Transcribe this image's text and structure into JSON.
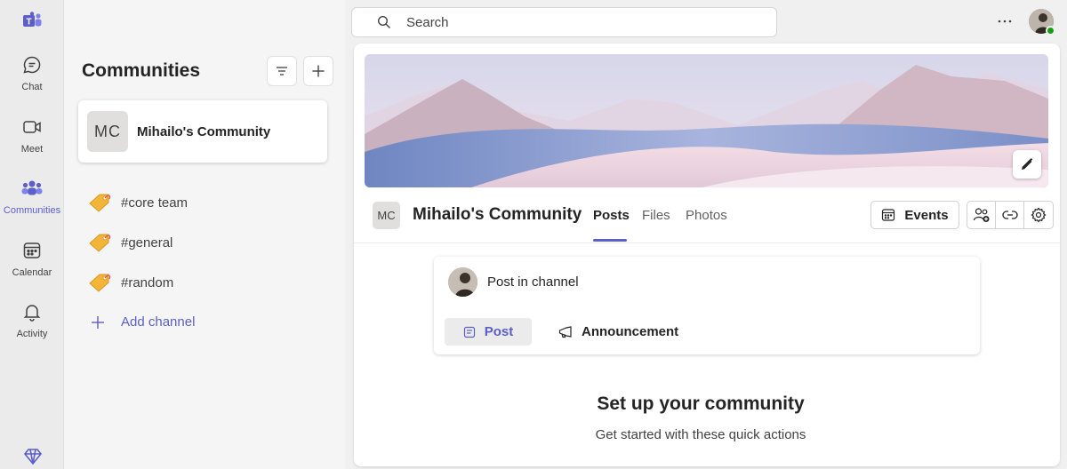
{
  "rail": {
    "logo_icon": "teams-logo-icon",
    "items": [
      {
        "label": "Chat",
        "icon": "chat-icon"
      },
      {
        "label": "Meet",
        "icon": "video-camera-icon"
      },
      {
        "label": "Communities",
        "icon": "communities-icon",
        "active": true
      },
      {
        "label": "Calendar",
        "icon": "calendar-icon"
      },
      {
        "label": "Activity",
        "icon": "bell-icon"
      }
    ],
    "premium_icon": "diamond-icon"
  },
  "sidebar": {
    "title": "Communities",
    "community": {
      "initials": "MC",
      "name": "Mihailo's Community"
    },
    "channels": [
      {
        "label": "#core team",
        "icon": "tag-icon"
      },
      {
        "label": "#general",
        "icon": "tag-icon"
      },
      {
        "label": "#random",
        "icon": "tag-icon"
      }
    ],
    "add_channel_label": "Add channel"
  },
  "topbar": {
    "search_placeholder": "Search",
    "more_label": "···"
  },
  "main": {
    "header": {
      "initials": "MC",
      "name": "Mihailo's Community",
      "tabs": [
        {
          "label": "Posts",
          "active": true
        },
        {
          "label": "Files"
        },
        {
          "label": "Photos"
        }
      ],
      "events_label": "Events"
    },
    "composer": {
      "prompt": "Post in channel",
      "post_label": "Post",
      "announcement_label": "Announcement"
    },
    "setup": {
      "title": "Set up your community",
      "subtitle": "Get started with these quick actions"
    }
  },
  "colors": {
    "accent": "#5b5fc7",
    "presence": "#13a10e",
    "tag": "#f2b53a"
  }
}
